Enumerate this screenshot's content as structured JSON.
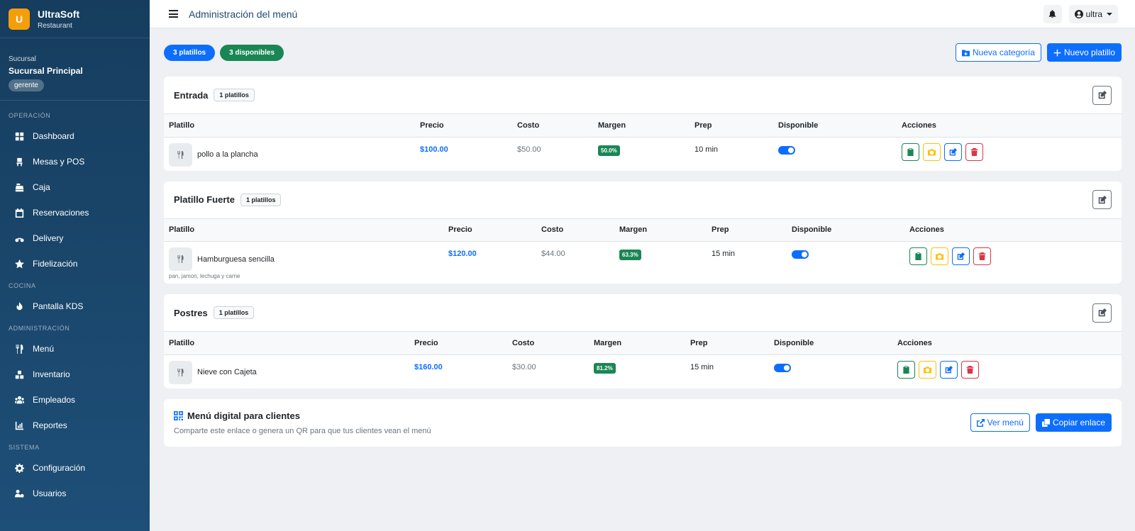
{
  "brand": {
    "logo_letter": "U",
    "name": "UltraSoft",
    "subtitle": "Restaurant"
  },
  "branch": {
    "label": "Sucursal",
    "name": "Sucursal Principal",
    "role": "gerente"
  },
  "sidebar": {
    "sections": [
      {
        "title": "Operación",
        "items": [
          {
            "label": "Dashboard",
            "icon": "dashboard-icon"
          },
          {
            "label": "Mesas y POS",
            "icon": "chair-icon"
          },
          {
            "label": "Caja",
            "icon": "cash-register-icon"
          },
          {
            "label": "Reservaciones",
            "icon": "calendar-icon"
          },
          {
            "label": "Delivery",
            "icon": "motorcycle-icon"
          },
          {
            "label": "Fidelización",
            "icon": "star-icon"
          }
        ]
      },
      {
        "title": "Cocina",
        "items": [
          {
            "label": "Pantalla KDS",
            "icon": "fire-icon"
          }
        ]
      },
      {
        "title": "Administración",
        "items": [
          {
            "label": "Menú",
            "icon": "utensils-icon"
          },
          {
            "label": "Inventario",
            "icon": "boxes-icon"
          },
          {
            "label": "Empleados",
            "icon": "users-icon"
          },
          {
            "label": "Reportes",
            "icon": "chart-icon"
          }
        ]
      },
      {
        "title": "Sistema",
        "items": [
          {
            "label": "Configuración",
            "icon": "gear-icon"
          },
          {
            "label": "Usuarios",
            "icon": "users-gear-icon"
          }
        ]
      }
    ]
  },
  "topbar": {
    "title": "Administración del menú",
    "user": "ultra"
  },
  "summary": {
    "dishes_pill": "3 platillos",
    "available_pill": "3 disponibles",
    "new_category_label": "Nueva categoría",
    "new_dish_label": "Nuevo platillo"
  },
  "columns": [
    "Platillo",
    "Precio",
    "Costo",
    "Margen",
    "Prep",
    "Disponible",
    "Acciones"
  ],
  "categories": [
    {
      "name": "Entrada",
      "count": "1 platillos",
      "dishes": [
        {
          "name": "pollo a la plancha",
          "description": "",
          "price": "$100.00",
          "cost": "$50.00",
          "margin": "50.0%",
          "prep": "10 min",
          "available": true
        }
      ]
    },
    {
      "name": "Platillo Fuerte",
      "count": "1 platillos",
      "dishes": [
        {
          "name": "Hamburguesa sencilla",
          "description": "pan, jamon, lechuga y carne",
          "price": "$120.00",
          "cost": "$44.00",
          "margin": "63.3%",
          "prep": "15 min",
          "available": true
        }
      ]
    },
    {
      "name": "Postres",
      "count": "1 platillos",
      "dishes": [
        {
          "name": "Nieve con Cajeta",
          "description": "",
          "price": "$160.00",
          "cost": "$30.00",
          "margin": "81.2%",
          "prep": "15 min",
          "available": true
        }
      ]
    }
  ],
  "digital_menu": {
    "title": "Menú digital para clientes",
    "subtitle": "Comparte este enlace o genera un QR para que tus clientes vean el menú",
    "view_label": "Ver menú",
    "copy_label": "Copiar enlace"
  },
  "colors": {
    "sidebar_top": "#163d5e",
    "sidebar_bottom": "#1e4f78",
    "primary": "#0d6efd",
    "success": "#198754",
    "warning": "#ffc107",
    "danger": "#dc3545",
    "brand": "#f59e0b"
  }
}
